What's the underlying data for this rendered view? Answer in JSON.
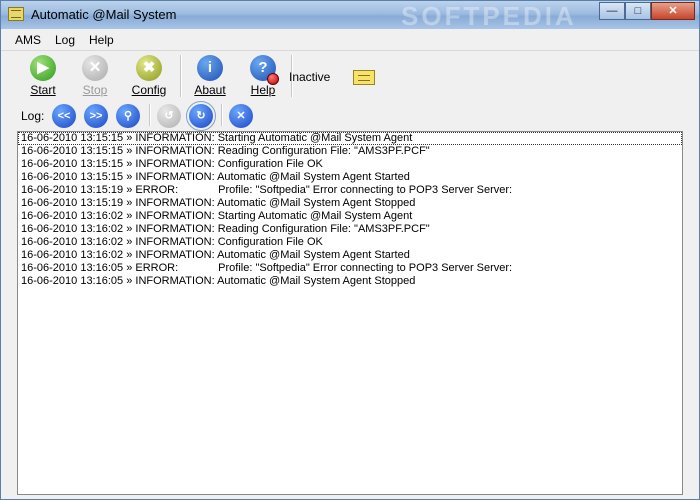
{
  "window": {
    "title": "Automatic @Mail System",
    "watermark": "SOFTPEDIA"
  },
  "menu": [
    {
      "label": "AMS"
    },
    {
      "label": "Log"
    },
    {
      "label": "Help"
    }
  ],
  "toolbar": {
    "start": "Start",
    "stop": "Stop",
    "config": "Config",
    "about": "Abaut",
    "help": "Help",
    "status": "Inactive"
  },
  "logbar": {
    "label": "Log:",
    "first": "<<",
    "next": ">>"
  },
  "log": [
    {
      "ts": "16-06-2010 13:15:15",
      "level": "INFORMATION:",
      "msg": "Starting Automatic @Mail System Agent"
    },
    {
      "ts": "16-06-2010 13:15:15",
      "level": "INFORMATION:",
      "msg": "Reading Configuration File: \"AMS3PF.PCF\""
    },
    {
      "ts": "16-06-2010 13:15:15",
      "level": "INFORMATION:",
      "msg": "Configuration File OK"
    },
    {
      "ts": "16-06-2010 13:15:15",
      "level": "INFORMATION:",
      "msg": "Automatic @Mail System Agent Started"
    },
    {
      "ts": "16-06-2010 13:15:19",
      "level": "ERROR:",
      "msg": "Profile: \"Softpedia\" Error connecting to POP3 Server Server:"
    },
    {
      "ts": "16-06-2010 13:15:19",
      "level": "INFORMATION:",
      "msg": "Automatic @Mail System Agent Stopped"
    },
    {
      "ts": "16-06-2010 13:16:02",
      "level": "INFORMATION:",
      "msg": "Starting Automatic @Mail System Agent"
    },
    {
      "ts": "16-06-2010 13:16:02",
      "level": "INFORMATION:",
      "msg": "Reading Configuration File: \"AMS3PF.PCF\""
    },
    {
      "ts": "16-06-2010 13:16:02",
      "level": "INFORMATION:",
      "msg": "Configuration File OK"
    },
    {
      "ts": "16-06-2010 13:16:02",
      "level": "INFORMATION:",
      "msg": "Automatic @Mail System Agent Started"
    },
    {
      "ts": "16-06-2010 13:16:05",
      "level": "ERROR:",
      "msg": "Profile: \"Softpedia\" Error connecting to POP3 Server Server:"
    },
    {
      "ts": "16-06-2010 13:16:05",
      "level": "INFORMATION:",
      "msg": "Automatic @Mail System Agent Stopped"
    }
  ]
}
